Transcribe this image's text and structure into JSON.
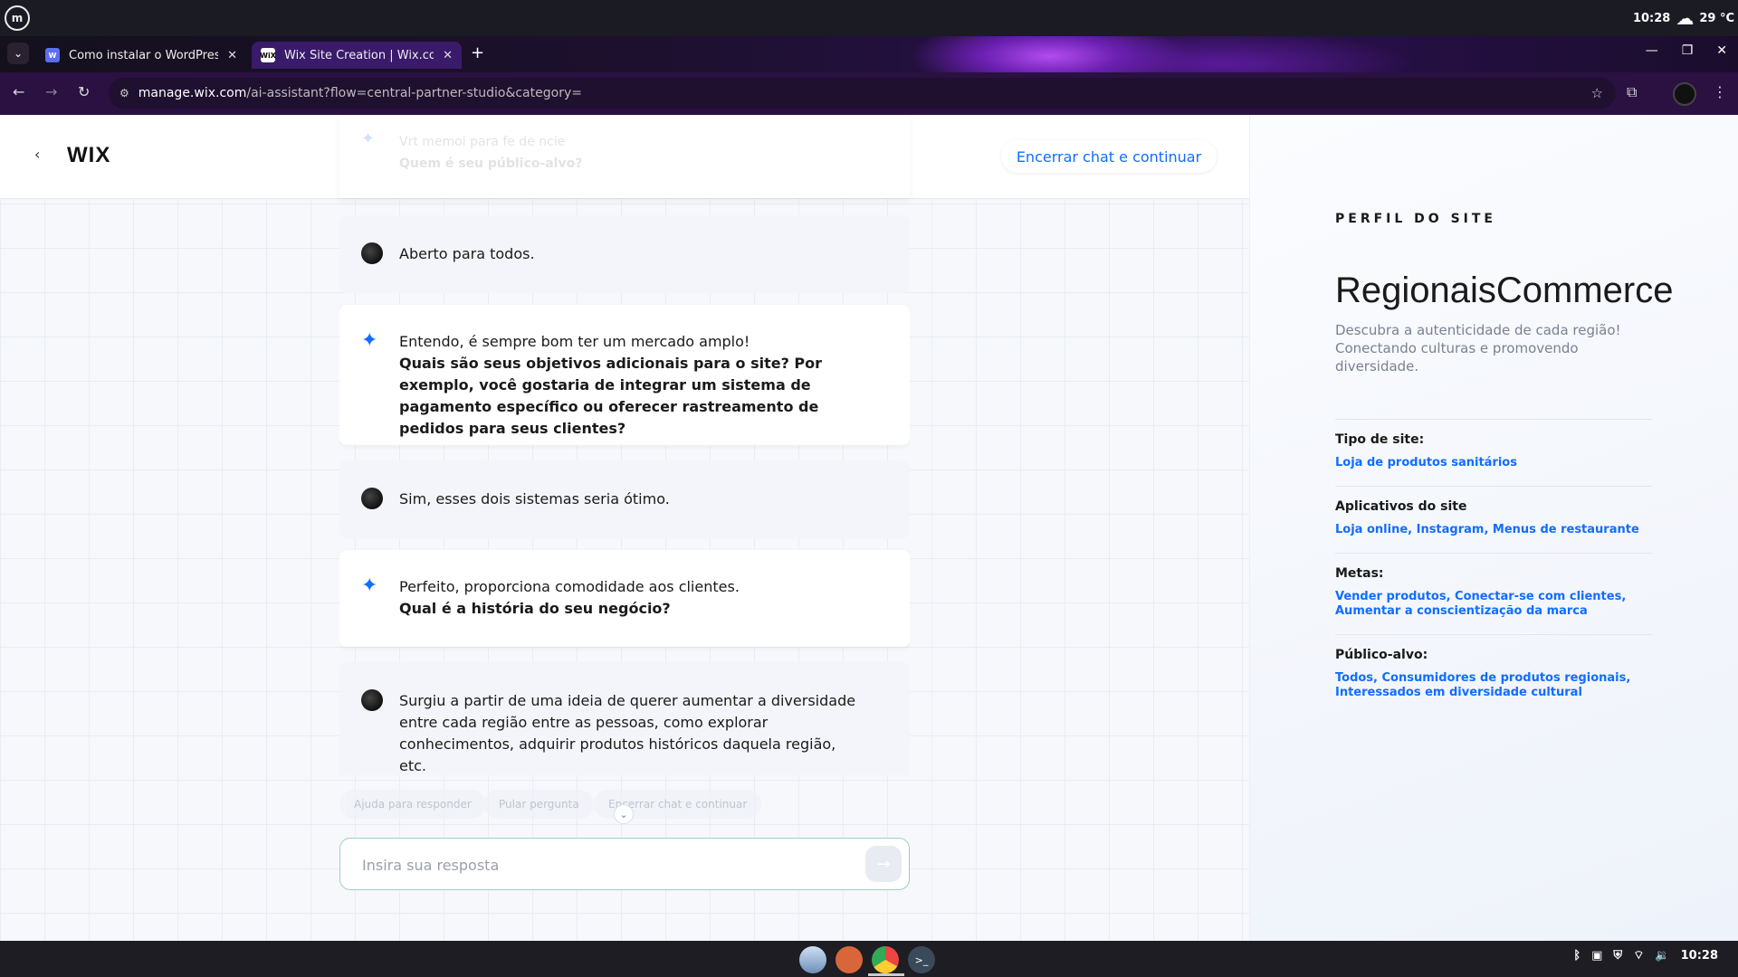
{
  "os": {
    "time": "10:28",
    "weather": "29 °C"
  },
  "tabs": [
    {
      "title": "Como instalar o WordPress r",
      "favicon": "W"
    },
    {
      "title": "Wix Site Creation | Wix.com",
      "favicon": "WiX"
    }
  ],
  "address": {
    "host": "manage.wix.com",
    "path": "/ai-assistant?flow=central-partner-studio&category="
  },
  "header": {
    "logo": "WIX",
    "end_chat": "Encerrar chat e continuar"
  },
  "chat": {
    "faded_top": {
      "line1": "Vrt memoi para fe de ncie",
      "line2": "Quem é seu público-alvo?"
    },
    "messages": [
      {
        "role": "user",
        "text": "Aberto para todos."
      },
      {
        "role": "ai",
        "intro": "Entendo, é sempre bom ter um mercado amplo!",
        "question": "Quais são seus objetivos adicionais para o site? Por exemplo, você gostaria de integrar um sistema de pagamento específico ou oferecer rastreamento de pedidos para seus clientes?"
      },
      {
        "role": "user",
        "text": "Sim, esses dois sistemas seria ótimo."
      },
      {
        "role": "ai",
        "intro": "Perfeito, proporciona comodidade aos clientes.",
        "question": "Qual é a história do seu negócio?"
      },
      {
        "role": "user",
        "text": "Surgiu a partir de uma ideia de querer aumentar a diversidade entre cada região entre as pessoas, como explorar conhecimentos, adquirir produtos históricos daquela região, etc."
      }
    ],
    "quick_actions": [
      "Ajuda para responder",
      "Pular pergunta",
      "Encerrar chat e continuar"
    ],
    "input_placeholder": "Insira sua resposta"
  },
  "profile": {
    "label": "PERFIL DO SITE",
    "name": "RegionaisCommerce",
    "description": "Descubra a autenticidade de cada região! Conectando culturas e promovendo diversidade.",
    "sections": [
      {
        "key": "Tipo de site:",
        "value": "Loja de produtos sanitários"
      },
      {
        "key": "Aplicativos do site",
        "value": "Loja online, Instagram, Menus de restaurante"
      },
      {
        "key": "Metas:",
        "value": "Vender produtos, Conectar-se com clientes, Aumentar a conscientização da marca"
      },
      {
        "key": "Público-alvo:",
        "value": "Todos, Consumidores de produtos regionais, Interessados em diversidade cultural"
      }
    ]
  },
  "taskbar": {
    "time": "10:28"
  }
}
